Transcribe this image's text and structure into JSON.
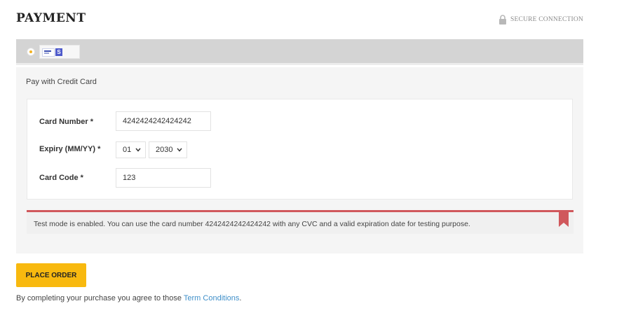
{
  "header": {
    "title": "PAYMENT",
    "secure_label": "SECURE CONNECTION",
    "secure_icon": "lock-icon"
  },
  "method_bar": {
    "selected": true,
    "accent_color": "#f3b221",
    "logos": [
      "visa-logo-icon",
      "stripe-logo-icon"
    ],
    "stripe_letter": "S"
  },
  "panel": {
    "pay_label": "Pay with Credit Card",
    "fields": {
      "card_number": {
        "label": "Card Number *",
        "value": "4242424242424242"
      },
      "expiry": {
        "label": "Expiry (MM/YY) *",
        "month": "01",
        "year": "2030"
      },
      "card_code": {
        "label": "Card Code *",
        "value": "123"
      }
    },
    "notice": {
      "text": "Test mode is enabled. You can use the card number 4242424242424242 with any CVC and a valid expiration date for testing purpose.",
      "border_color": "#d0585c",
      "icon": "bookmark-icon"
    }
  },
  "actions": {
    "place_order_label": "PLACE ORDER",
    "button_color": "#f8b90f"
  },
  "footer": {
    "agree_prefix": "By completing your purchase you agree to those ",
    "terms_link": "Term Conditions",
    "agree_suffix": "."
  }
}
